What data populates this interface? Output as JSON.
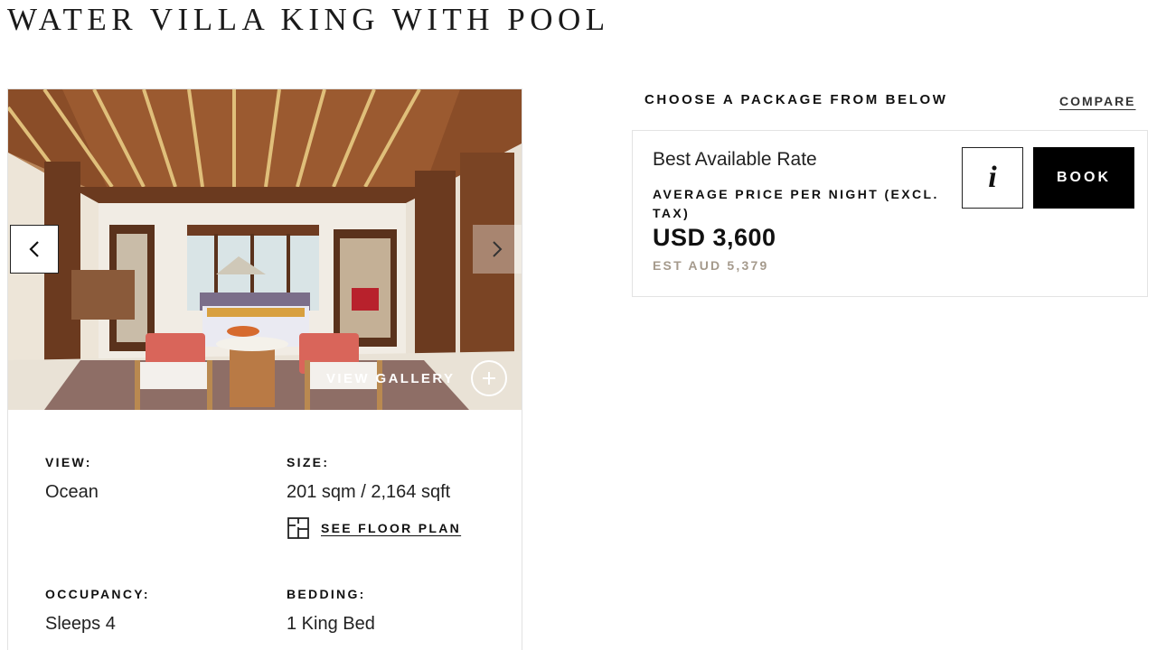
{
  "room": {
    "title": "WATER VILLA KING WITH POOL"
  },
  "gallery": {
    "prev_icon": "chevron-left-icon",
    "next_icon": "chevron-right-icon",
    "view_gallery_label": "VIEW GALLERY",
    "plus_icon": "plus-icon"
  },
  "specs": {
    "view_label": "VIEW:",
    "view_value": "Ocean",
    "size_label": "SIZE:",
    "size_value": "201 sqm / 2,164 sqft",
    "floor_plan_label": "SEE FLOOR PLAN",
    "occupancy_label": "OCCUPANCY:",
    "occupancy_value": "Sleeps 4",
    "bedding_label": "BEDDING:",
    "bedding_value": "1 King Bed"
  },
  "packages": {
    "heading": "CHOOSE A PACKAGE FROM BELOW",
    "compare_label": "COMPARE",
    "rate": {
      "name": "Best Available Rate",
      "avg_label": "AVERAGE PRICE PER NIGHT (EXCL. TAX)",
      "price": "USD 3,600",
      "est_price": "EST AUD 5,379",
      "info_label": "i",
      "book_label": "BOOK"
    }
  },
  "colors": {
    "book_bg": "#000000",
    "est_price": "#a59a8c"
  }
}
